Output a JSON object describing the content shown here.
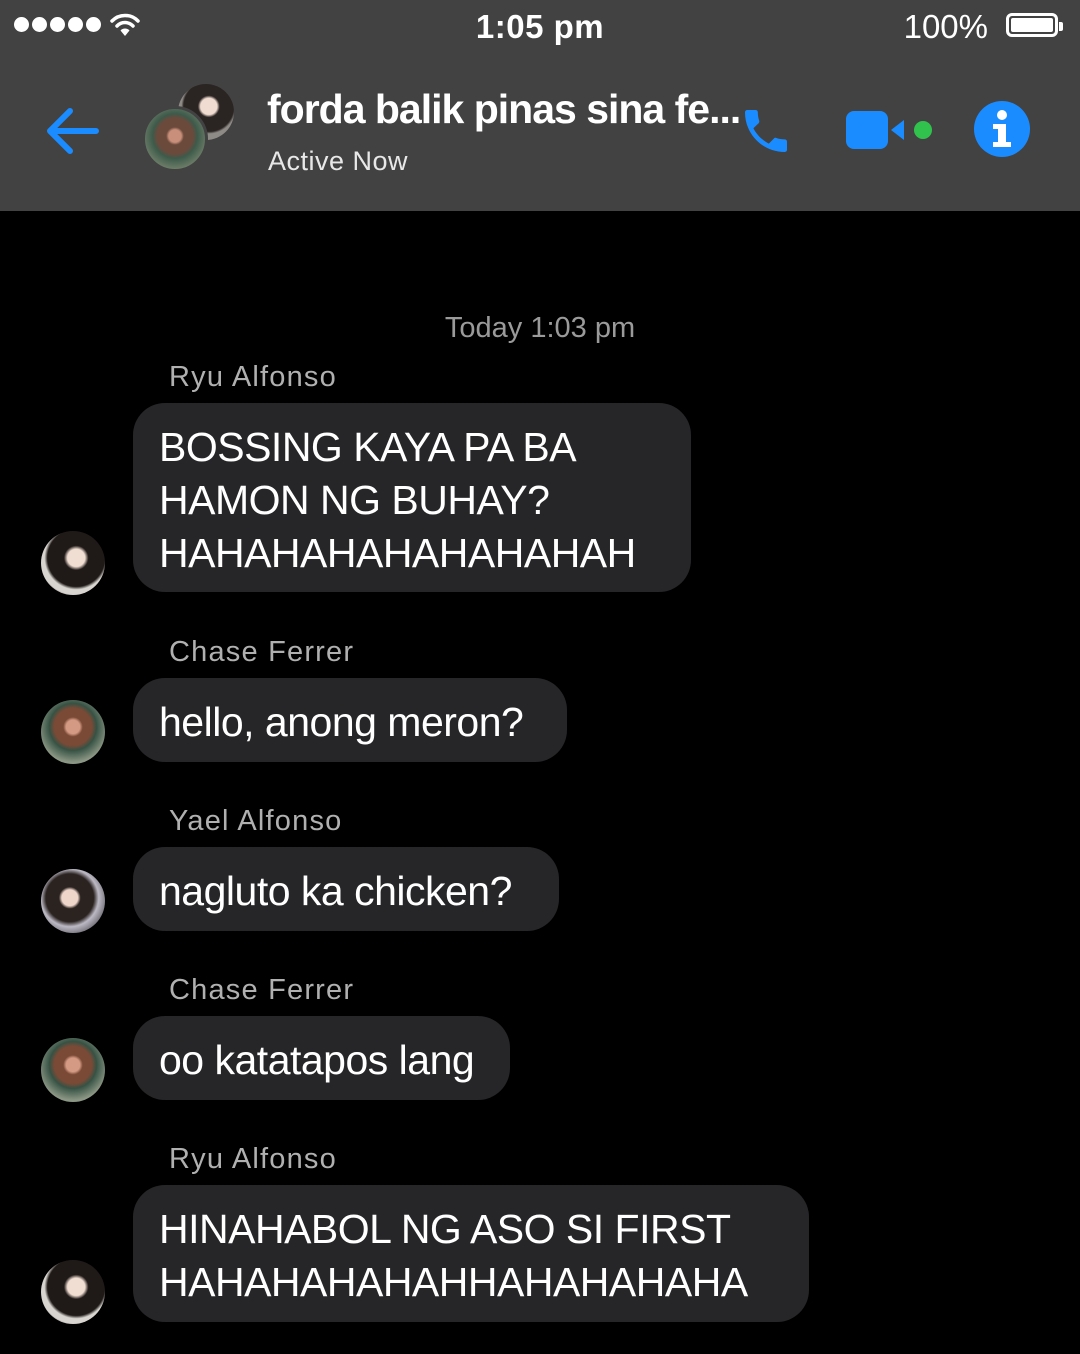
{
  "status_bar": {
    "time": "1:05 pm",
    "battery": "100%"
  },
  "header": {
    "title": "forda balik pinas sina fe...",
    "status": "Active Now"
  },
  "colors": {
    "accent": "#1a8cff",
    "online": "#31c24d",
    "header_bg": "#424242",
    "bubble_bg": "#262528"
  },
  "conversation": {
    "timestamp": "Today 1:03 pm",
    "messages": [
      {
        "sender": "Ryu Alfonso",
        "text": "BOSSING KAYA PA BA\nHAMON NG BUHAY?\nHAHAHAHAHAHAHAHAH"
      },
      {
        "sender": "Chase Ferrer",
        "text": "hello, anong meron?"
      },
      {
        "sender": "Yael Alfonso",
        "text": "nagluto ka chicken?"
      },
      {
        "sender": "Chase Ferrer",
        "text": "oo katatapos lang"
      },
      {
        "sender": "Ryu Alfonso",
        "text": "HINAHABOL NG ASO SI FIRST\nHAHAHAHAHAHHAHAHAHAHA"
      }
    ]
  }
}
